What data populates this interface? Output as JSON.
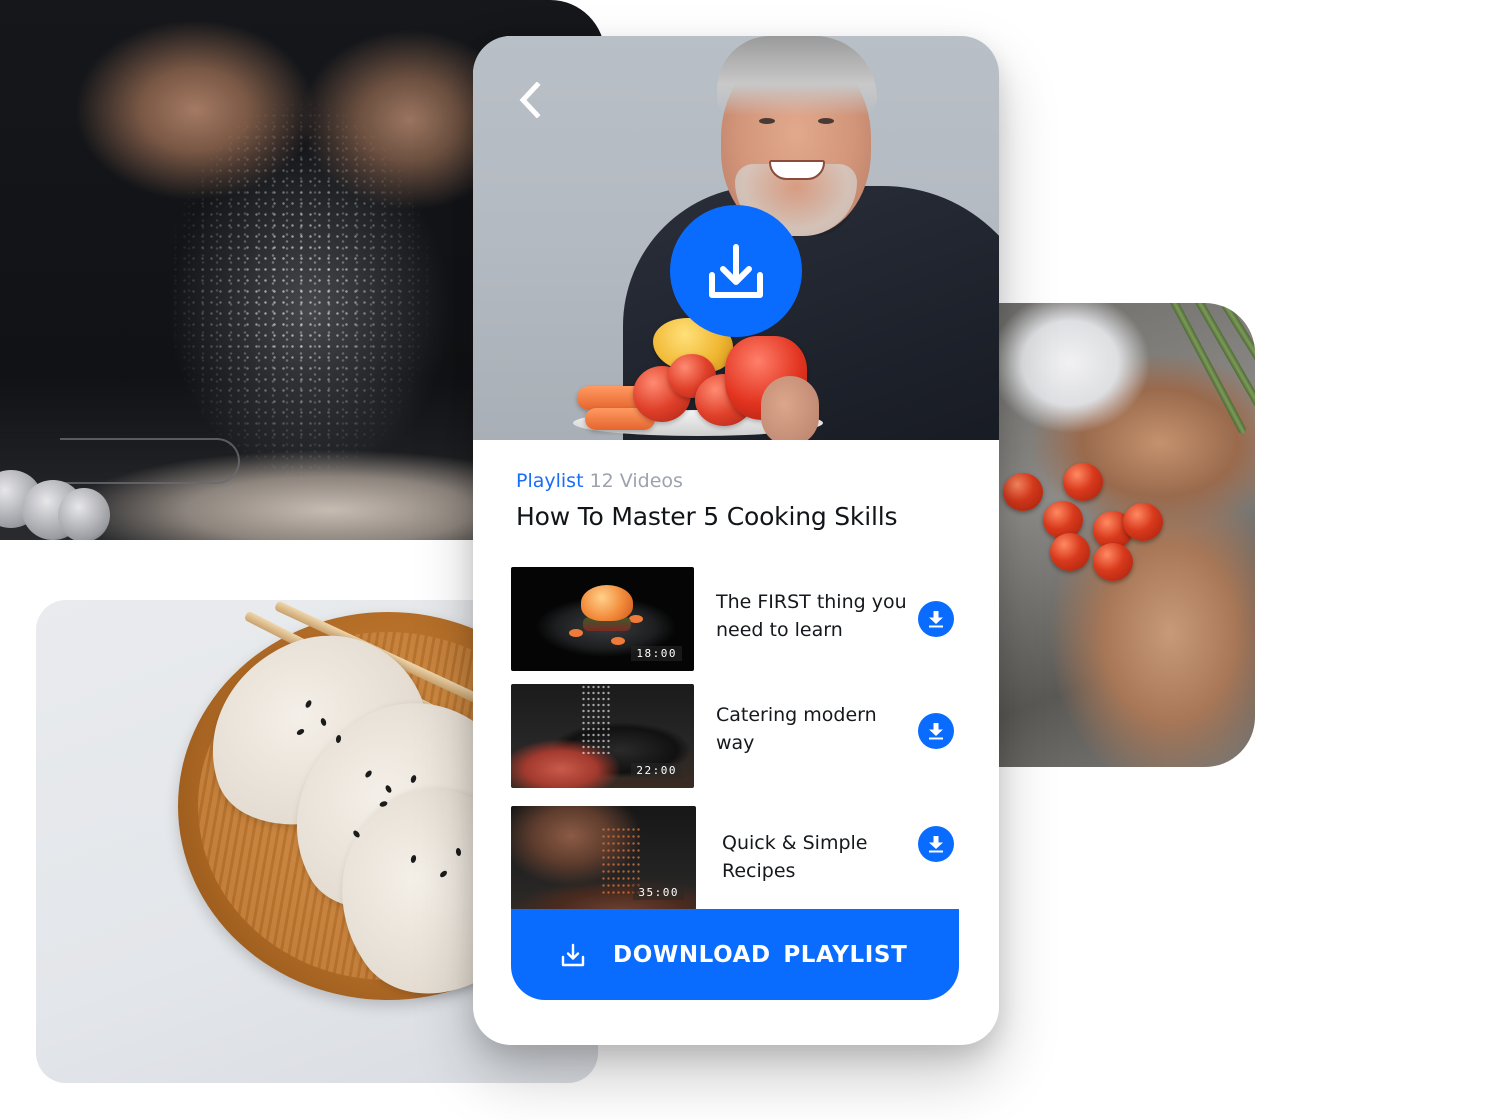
{
  "colors": {
    "accent": "#0a6cff",
    "playlist_label": "#1a6ef5",
    "muted_text": "#9ca3ad",
    "primary_text": "#111418",
    "card_background": "#ffffff"
  },
  "background_photos": [
    {
      "subject": "hands sprinkling flour over whisk and eggs"
    },
    {
      "subject": "dumplings with sesame on wooden plate with chopsticks"
    },
    {
      "subject": "hands holding cherry tomatoes and knife over sink"
    }
  ],
  "hero": {
    "subject": "smiling chef holding plate of vegetables",
    "back_icon": "chevron-left-icon",
    "download_icon": "download-icon"
  },
  "playlist": {
    "label": "Playlist",
    "count": "12 Videos",
    "title": "How To Master 5 Cooking Skills"
  },
  "videos": [
    {
      "title": "The FIRST thing you need to learn",
      "duration": "18:00",
      "thumbnail": "plated shrimp dish",
      "icon": "download-icon"
    },
    {
      "title": "Catering modern way",
      "duration": "22:00",
      "thumbnail": "salt sprinkled into pot with meat",
      "icon": "download-icon"
    },
    {
      "title": "Quick & Simple Recipes",
      "duration": "35:00",
      "thumbnail": "hand seasoning meat",
      "icon": "download-icon"
    }
  ],
  "download_playlist": {
    "label": "DOWNLOAD  PLAYLIST",
    "icon": "download-tray-icon"
  }
}
